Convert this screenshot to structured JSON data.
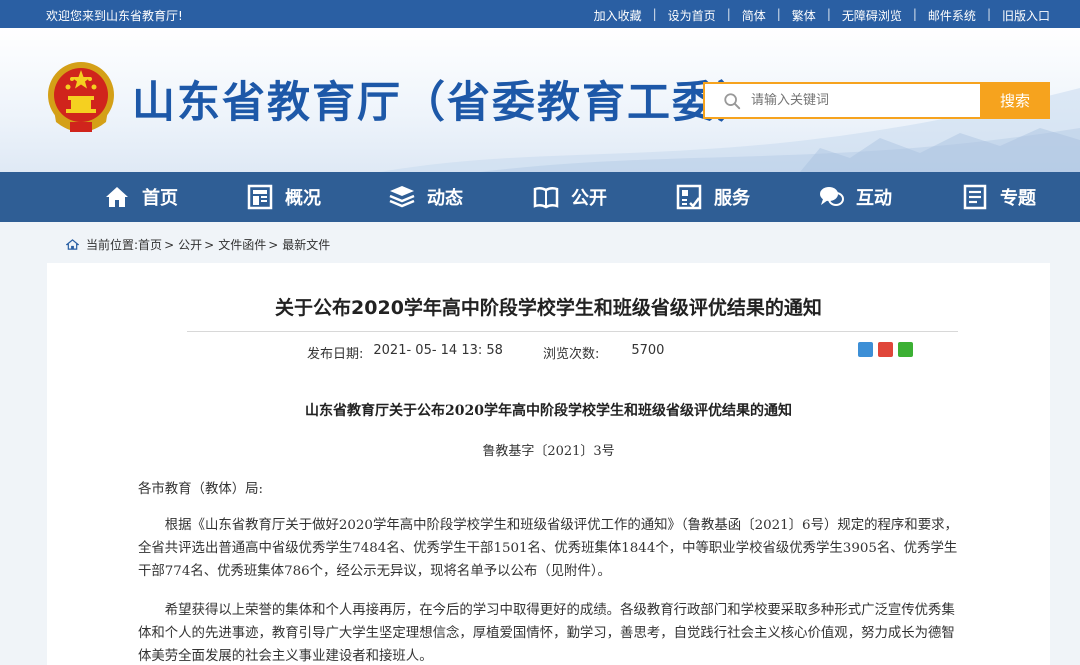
{
  "topbar": {
    "welcome": "欢迎您来到山东省教育厅!",
    "links": [
      "加入收藏",
      "设为首页",
      "简体",
      "繁体",
      "无障碍浏览",
      "邮件系统",
      "旧版入口"
    ]
  },
  "header": {
    "title": "山东省教育厅（省委教育工委）",
    "search_placeholder": "请输入关键词",
    "search_button": "搜索"
  },
  "nav": [
    {
      "label": "首页",
      "icon": "home-icon"
    },
    {
      "label": "概况",
      "icon": "overview-icon"
    },
    {
      "label": "动态",
      "icon": "stack-icon"
    },
    {
      "label": "公开",
      "icon": "book-icon"
    },
    {
      "label": "服务",
      "icon": "service-icon"
    },
    {
      "label": "互动",
      "icon": "chat-icon"
    },
    {
      "label": "专题",
      "icon": "topic-icon"
    }
  ],
  "breadcrumb": {
    "prefix": "当前位置:",
    "items": [
      "首页",
      "公开",
      "文件函件",
      "最新文件"
    ]
  },
  "article": {
    "title": "关于公布2020学年高中阶段学校学生和班级省级评优结果的通知",
    "date_label": "发布日期:",
    "date": "2021- 05- 14 13: 58",
    "views_label": "浏览次数:",
    "views": "5700",
    "doc_title": "山东省教育厅关于公布2020学年高中阶段学校学生和班级省级评优结果的通知",
    "doc_no": "鲁教基字〔2021〕3号",
    "addressee": "各市教育（教体）局:",
    "para1": "根据《山东省教育厅关于做好2020学年高中阶段学校学生和班级省级评优工作的通知》（鲁教基函〔2021〕6号）规定的程序和要求，全省共评选出普通高中省级优秀学生7484名、优秀学生干部1501名、优秀班集体1844个，中等职业学校省级优秀学生3905名、优秀学生干部774名、优秀班集体786个，经公示无异议，现将名单予以公布（见附件）。",
    "para2": "希望获得以上荣誉的集体和个人再接再厉，在今后的学习中取得更好的成绩。各级教育行政部门和学校要采取多种形式广泛宣传优秀集体和个人的先进事迹，教育引导广大学生坚定理想信念，厚植爱国情怀，勤学习，善思考，自觉践行社会主义核心价值观，努力成长为德智体美劳全面发展的社会主义事业建设者和接班人。"
  },
  "colors": {
    "topbar": "#2a5fa3",
    "nav": "#2f5e95",
    "title_blue": "#1d58a8",
    "accent_orange": "#f6a31e"
  }
}
